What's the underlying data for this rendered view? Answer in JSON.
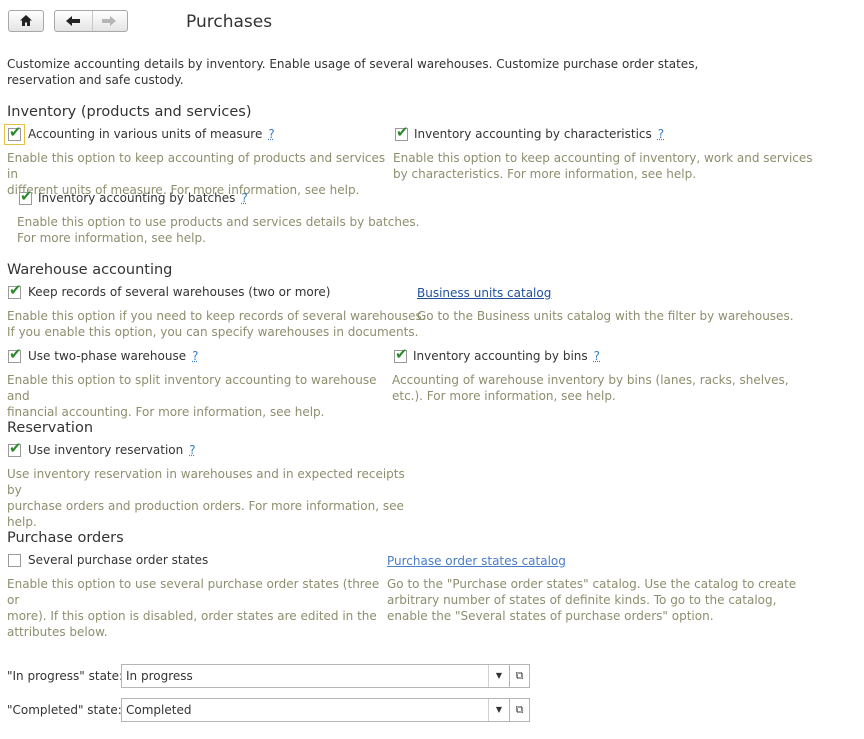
{
  "toolbar": {
    "home_icon": "home-icon",
    "back_icon": "arrow-left-icon",
    "forward_icon": "arrow-right-icon"
  },
  "page": {
    "title": "Purchases",
    "intro": "Customize accounting details by inventory. Enable usage of several warehouses. Customize purchase order states,\nreservation and safe custody."
  },
  "inventory": {
    "heading": "Inventory (products and services)",
    "units": {
      "label": "Accounting in various units of measure",
      "checked": true,
      "help": "?",
      "desc": "Enable this option to keep accounting of products and services in\ndifferent units of measure. For more information, see help."
    },
    "characteristics": {
      "label": "Inventory accounting by characteristics",
      "checked": true,
      "help": "?",
      "desc": "Enable this option to keep accounting of inventory, work and services\nby characteristics. For more information, see help."
    },
    "batches": {
      "label": "Inventory accounting by batches",
      "checked": true,
      "help": "?",
      "desc": "Enable this option to use products and services details by batches.\nFor more information, see help."
    }
  },
  "warehouse": {
    "heading": "Warehouse accounting",
    "several": {
      "label": "Keep records of several warehouses (two or more)",
      "checked": true,
      "desc": "Enable this option if you need to keep records of several warehouses.\nIf you enable this option, you can specify warehouses in documents."
    },
    "catalog_link": "Business units catalog",
    "catalog_desc": "Go to the Business units catalog with the filter by warehouses.",
    "two_phase": {
      "label": "Use two-phase warehouse",
      "checked": true,
      "help": "?",
      "desc": "Enable this option to split inventory accounting to warehouse and\nfinancial accounting. For more information, see help."
    },
    "bins": {
      "label": "Inventory accounting by bins",
      "checked": true,
      "help": "?",
      "desc": "Accounting of warehouse inventory by bins (lanes, racks, shelves,\netc.). For more information, see help."
    }
  },
  "reservation": {
    "heading": "Reservation",
    "use": {
      "label": "Use inventory reservation",
      "checked": true,
      "help": "?",
      "desc": "Use inventory reservation in warehouses and in expected receipts by\npurchase orders and production orders. For more information, see\nhelp."
    }
  },
  "purchase_orders": {
    "heading": "Purchase orders",
    "several_states": {
      "label": "Several purchase order states",
      "checked": false,
      "desc": "Enable this option to use several purchase order states (three or\nmore). If this option is disabled, order states are edited in the\nattributes below."
    },
    "catalog_link": "Purchase order states catalog",
    "catalog_desc": "Go to the \"Purchase order states\" catalog. Use the catalog to create\narbitrary number of states of definite kinds. To go to the catalog,\nenable the \"Several states of purchase orders\" option.",
    "in_progress": {
      "label": "\"In progress\" state:",
      "value": "In progress"
    },
    "completed": {
      "label": "\"Completed\" state:",
      "value": "Completed"
    }
  }
}
